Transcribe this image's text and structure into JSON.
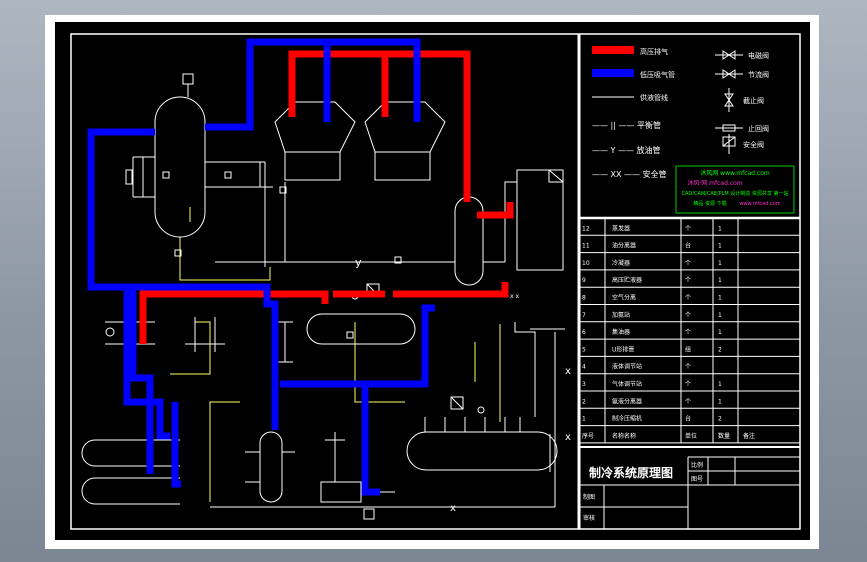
{
  "drawing": {
    "title": "制冷系统原理图",
    "title_block": {
      "ratio_label": "比例",
      "drawing_no_label": "图号",
      "draw_label": "制图",
      "review_label": "审核"
    }
  },
  "legend": {
    "items": [
      {
        "label": "高压排气",
        "symbol": "red-pipe"
      },
      {
        "label": "低压吸气管",
        "symbol": "blue-pipe"
      },
      {
        "label": "供液管线",
        "symbol": "white-line"
      },
      {
        "label": "—— || —— 平衡管",
        "symbol": "balance-line"
      },
      {
        "label": "—— Y —— 放油管",
        "symbol": "oil-line"
      },
      {
        "label": "—— XX —— 安全管",
        "symbol": "safety-line"
      }
    ],
    "valves": [
      {
        "label": "电磁阀",
        "symbol": "solenoid-valve-icon"
      },
      {
        "label": "节流阀",
        "symbol": "throttle-valve-icon"
      },
      {
        "label": "截止阀",
        "symbol": "shutoff-valve-icon"
      },
      {
        "label": "止回阀",
        "symbol": "check-valve-icon"
      },
      {
        "label": "安全阀",
        "symbol": "safety-valve-icon"
      }
    ]
  },
  "watermark": {
    "line1": "沐风网 www.mfcad.com",
    "line2": "沐风·网 mfcad.com",
    "line3": "CAD/CAM/CAE/PLM 设计制造 资源共享 第一站",
    "line4": "精品 资源 下载",
    "line5": "www.mfcad.com"
  },
  "parts_table": {
    "headers": [
      "序号",
      "名称名称",
      "单位",
      "数量",
      "备注"
    ],
    "rows": [
      {
        "no": "12",
        "name": "蒸发器",
        "unit": "个",
        "qty": "1",
        "note": ""
      },
      {
        "no": "11",
        "name": "油分离器",
        "unit": "台",
        "qty": "1",
        "note": ""
      },
      {
        "no": "10",
        "name": "冷凝器",
        "unit": "个",
        "qty": "1",
        "note": ""
      },
      {
        "no": "9",
        "name": "高压贮液器",
        "unit": "个",
        "qty": "1",
        "note": ""
      },
      {
        "no": "8",
        "name": "空气分离",
        "unit": "个",
        "qty": "1",
        "note": ""
      },
      {
        "no": "7",
        "name": "加氨站",
        "unit": "个",
        "qty": "1",
        "note": ""
      },
      {
        "no": "6",
        "name": "集油器",
        "unit": "个",
        "qty": "1",
        "note": ""
      },
      {
        "no": "5",
        "name": "U形排管",
        "unit": "组",
        "qty": "2",
        "note": ""
      },
      {
        "no": "4",
        "name": "液体调节站",
        "unit": "个",
        "qty": "",
        "note": ""
      },
      {
        "no": "3",
        "name": "气体调节站",
        "unit": "个",
        "qty": "1",
        "note": ""
      },
      {
        "no": "2",
        "name": "氨液分离器",
        "unit": "个",
        "qty": "1",
        "note": ""
      },
      {
        "no": "1",
        "name": "制冷压缩机",
        "unit": "台",
        "qty": "2",
        "note": ""
      }
    ]
  },
  "line_labels": {
    "y_mid": "y",
    "xx_mid": "x x",
    "x_bottom": "x",
    "x_right1": "x",
    "x_right2": "x"
  },
  "colors": {
    "high_pressure": "#ff0000",
    "low_pressure": "#0000ff",
    "equipment": "#ffffff",
    "liquid_line": "#ffff66",
    "watermark_text": "#00ff00",
    "watermark_pink": "#ff33cc"
  }
}
